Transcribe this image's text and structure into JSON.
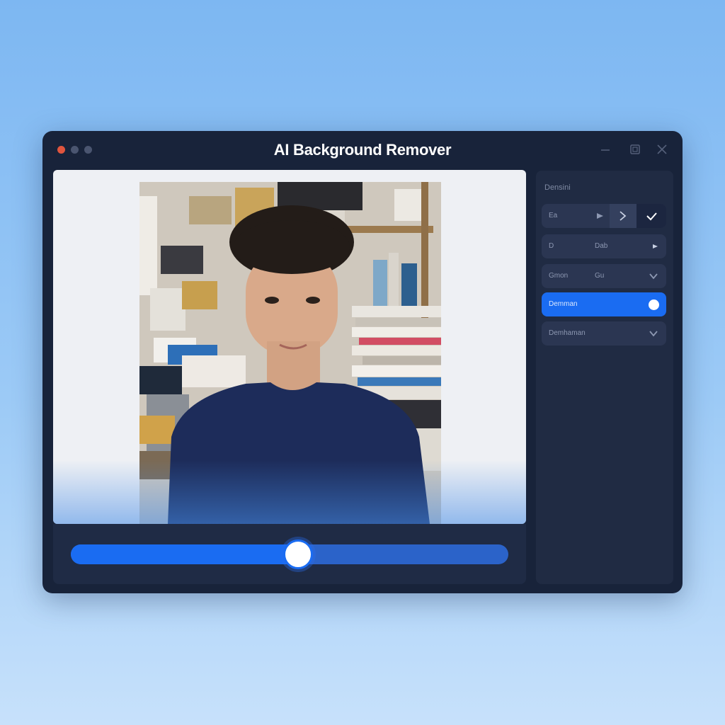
{
  "window": {
    "title": "AI Background Remover"
  },
  "panel": {
    "heading": "Densini",
    "rows": [
      {
        "label": "Ea",
        "value": ""
      },
      {
        "label": "D",
        "value": "Dab"
      },
      {
        "label": "Gmon",
        "value": "Gu"
      },
      {
        "label": "Demman",
        "value": ""
      },
      {
        "label": "Demhaman",
        "value": ""
      }
    ]
  },
  "slider": {
    "value": 0.52
  },
  "colors": {
    "accent": "#1a6cf2",
    "window_bg": "#18233a",
    "panel_bg": "#202b43"
  }
}
